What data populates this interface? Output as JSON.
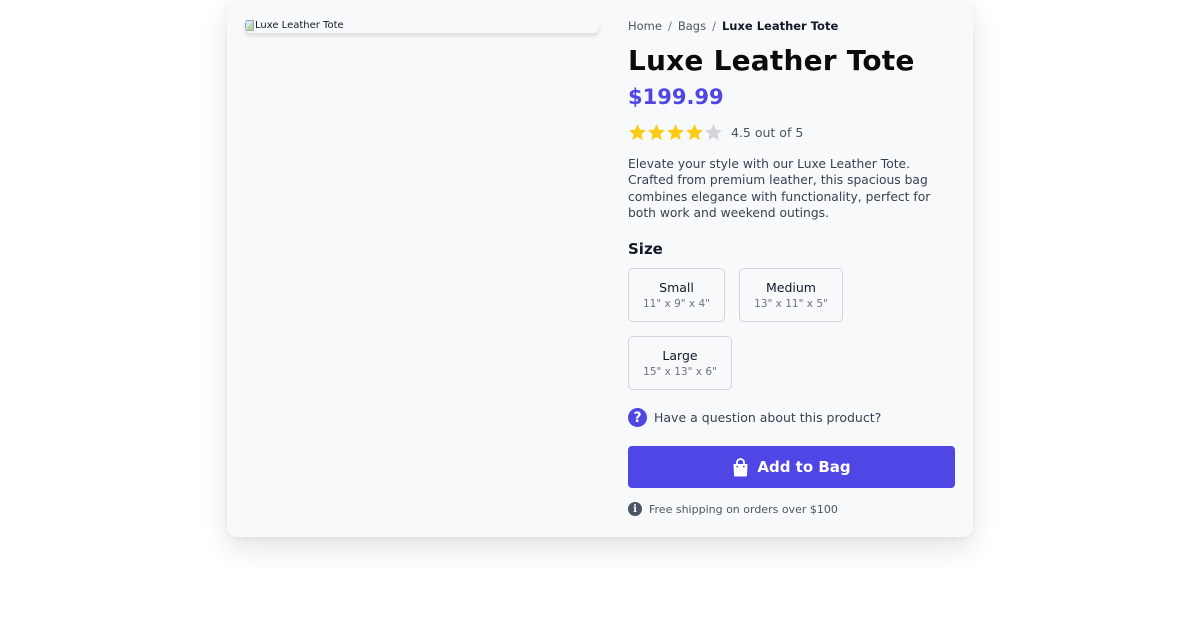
{
  "product": {
    "image_alt": "Luxe Leather Tote",
    "breadcrumb": {
      "home": "Home",
      "category": "Bags",
      "current": "Luxe Leather Tote"
    },
    "title": "Luxe Leather Tote",
    "price": "$199.99",
    "rating": {
      "value": 4.5,
      "max": 5,
      "text": "4.5 out of 5"
    },
    "description": "Elevate your style with our Luxe Leather Tote. Crafted from premium leather, this spacious bag combines elegance with functionality, perfect for both work and weekend outings.",
    "size": {
      "label": "Size",
      "options": [
        {
          "name": "Small",
          "dims": "11\" x 9\" x 4\""
        },
        {
          "name": "Medium",
          "dims": "13\" x 11\" x 5\""
        },
        {
          "name": "Large",
          "dims": "15\" x 13\" x 6\""
        }
      ]
    },
    "question_text": "Have a question about this product?",
    "add_to_bag_label": "Add to Bag",
    "shipping_text": "Free shipping on orders over $100"
  },
  "icons": {
    "star": "star-icon",
    "question": "question-circle-icon",
    "bag": "shopping-bag-icon",
    "info": "info-circle-icon"
  },
  "colors": {
    "accent": "#4f46e5",
    "star_filled": "#facc15",
    "star_empty": "#d1d5db",
    "card_bg": "#f8f9fb"
  }
}
